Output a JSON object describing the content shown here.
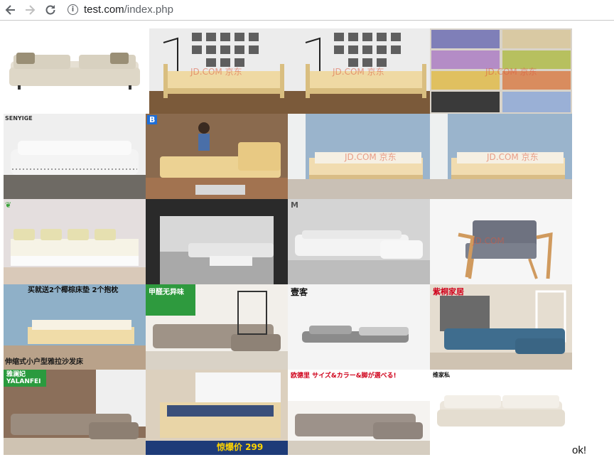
{
  "browser": {
    "url_host": "test.com",
    "url_path": "/index.php",
    "back_icon": "arrow-left-icon",
    "forward_icon": "arrow-right-icon",
    "reload_icon": "reload-icon",
    "info_icon": "info-icon"
  },
  "status_text": "ok!",
  "gallery": {
    "rows": 5,
    "columns": 4,
    "tiles": [
      {
        "subject": "beige sofa",
        "watermark": "",
        "badge": ""
      },
      {
        "subject": "wooden daybed",
        "watermark": "JD.COM 京东",
        "badge": ""
      },
      {
        "subject": "wooden daybed",
        "watermark": "JD.COM 京东",
        "badge": ""
      },
      {
        "subject": "color swatch sofas",
        "watermark": "JD.COM 京东",
        "badge": ""
      },
      {
        "subject": "white studded sofa",
        "watermark": "",
        "badge": "SENYIGE"
      },
      {
        "subject": "leather sectional with person",
        "watermark": "",
        "badge": "B"
      },
      {
        "subject": "wooden daybed blue wall",
        "watermark": "JD.COM 京东",
        "badge": ""
      },
      {
        "subject": "wooden daybed blue wall",
        "watermark": "JD.COM 京东",
        "badge": ""
      },
      {
        "subject": "white storage daybed",
        "watermark": "",
        "badge": ""
      },
      {
        "subject": "gray sofa living room",
        "watermark": "",
        "badge": ""
      },
      {
        "subject": "white chesterfield sectional",
        "watermark": "",
        "badge": "M"
      },
      {
        "subject": "gray armchair",
        "watermark": "JD.COM",
        "badge": ""
      },
      {
        "subject": "pull-out daybed",
        "watermark": "",
        "badge": "买就送2个椰棕床垫 2个抱枕",
        "footer": "伸缩式小户型雅拉沙发床"
      },
      {
        "subject": "gray fabric sectional",
        "watermark": "",
        "badge": "甲醛无异味"
      },
      {
        "subject": "low gray sofa",
        "watermark": "",
        "badge": "壹客"
      },
      {
        "subject": "blue sectional",
        "watermark": "",
        "badge": "紫桐家居"
      },
      {
        "subject": "brown sectional",
        "watermark": "",
        "badge": "雅澜妃 YALANFEI"
      },
      {
        "subject": "pine sofa bed",
        "watermark": "",
        "badge": "",
        "footer": "惊爆价 299"
      },
      {
        "subject": "gray sectional japanese ad",
        "watermark": "",
        "badge": "欧德里 サイズ&カラー&脚が選べる!"
      },
      {
        "subject": "cream sofa",
        "watermark": "",
        "badge": "维家私"
      }
    ]
  }
}
